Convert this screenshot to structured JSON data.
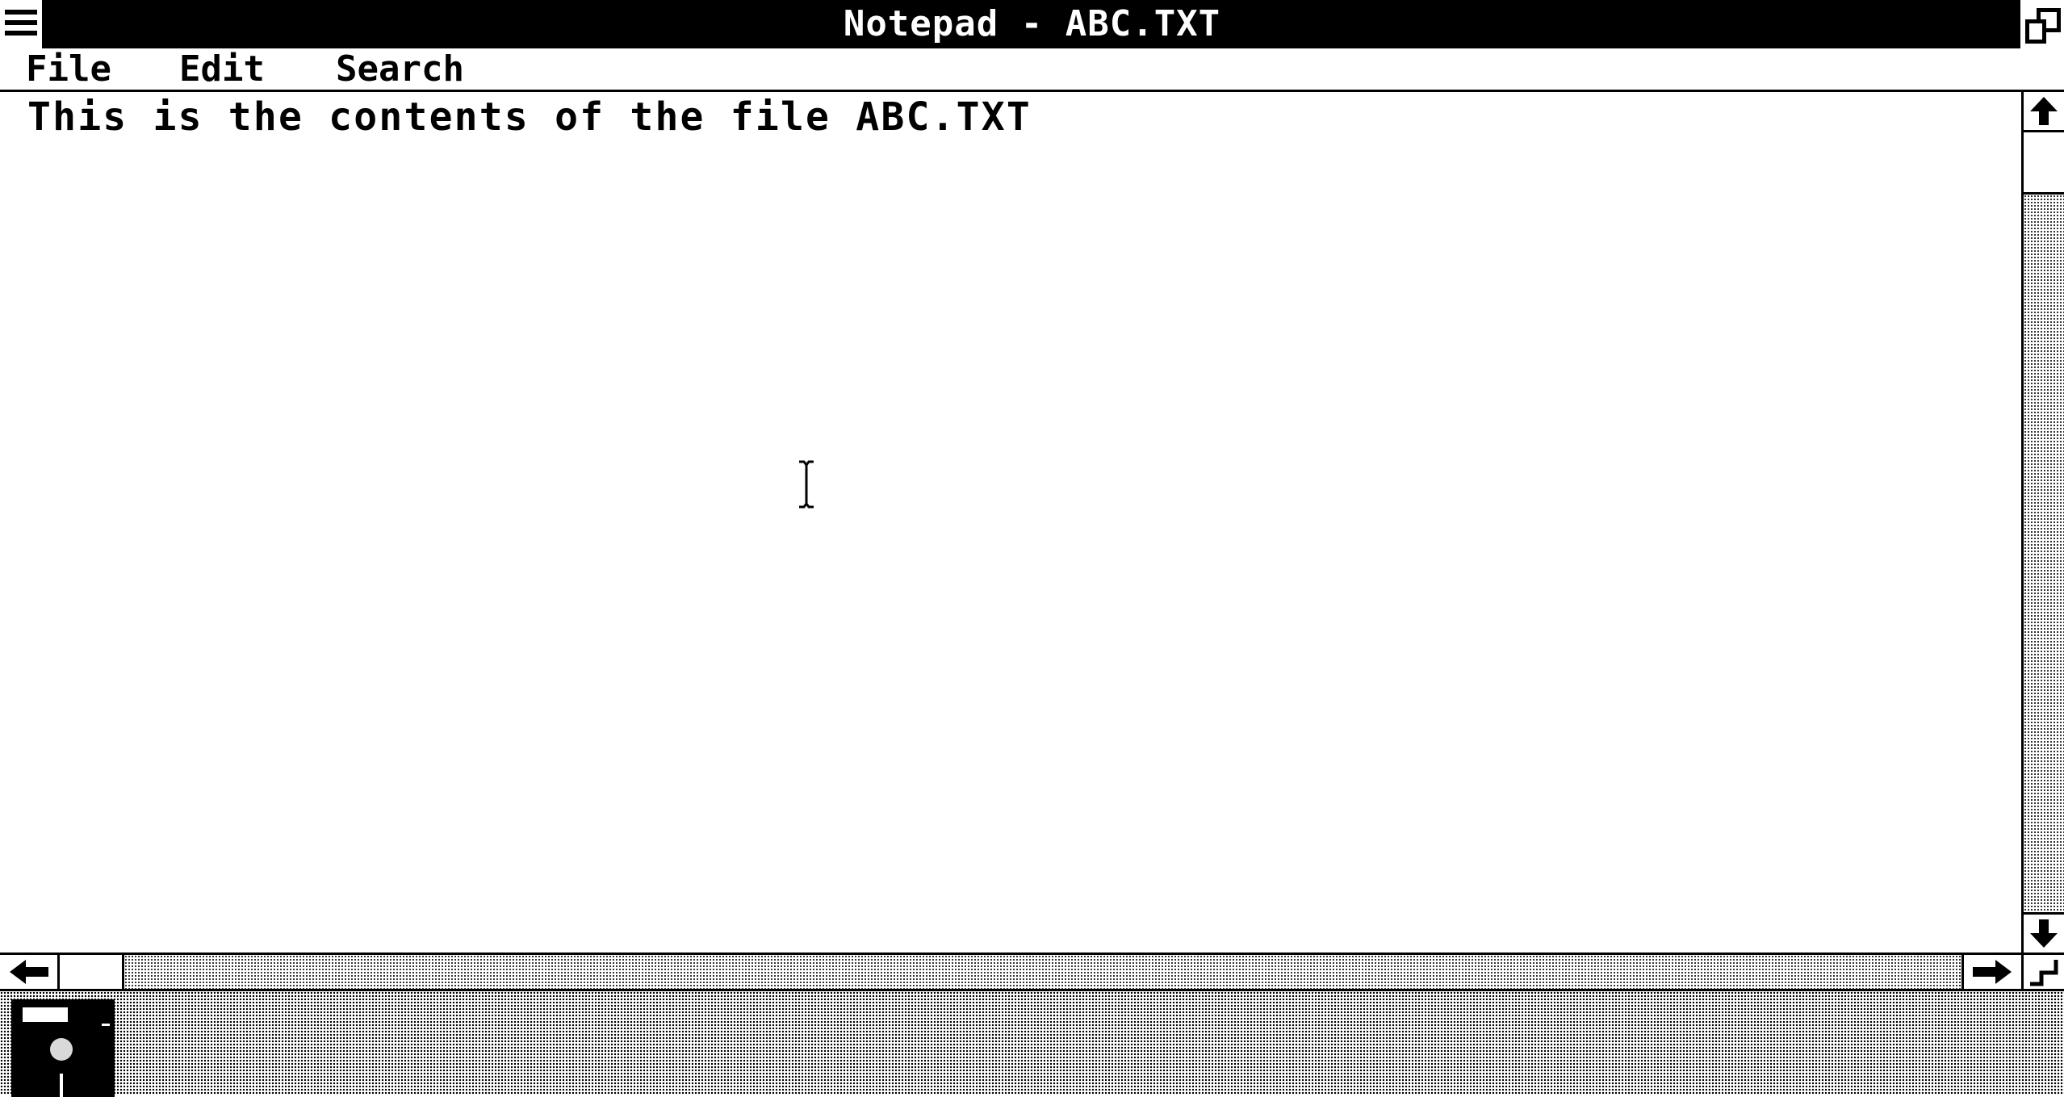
{
  "window": {
    "title": "Notepad - ABC.TXT"
  },
  "menu": {
    "items": [
      {
        "label": "File"
      },
      {
        "label": "Edit"
      },
      {
        "label": "Search"
      }
    ]
  },
  "document": {
    "text": "This is the contents of the file ABC.TXT"
  },
  "icons": {
    "system_menu": "system-menu-icon",
    "maximize": "maximize-icon",
    "scroll_up": "arrow-up-icon",
    "scroll_down": "arrow-down-icon",
    "scroll_left": "arrow-left-icon",
    "scroll_right": "arrow-right-icon",
    "cursor": "text-cursor-icon",
    "minimized_app": "disk-drive-icon"
  },
  "colors": {
    "foreground": "#000000",
    "background": "#ffffff"
  }
}
